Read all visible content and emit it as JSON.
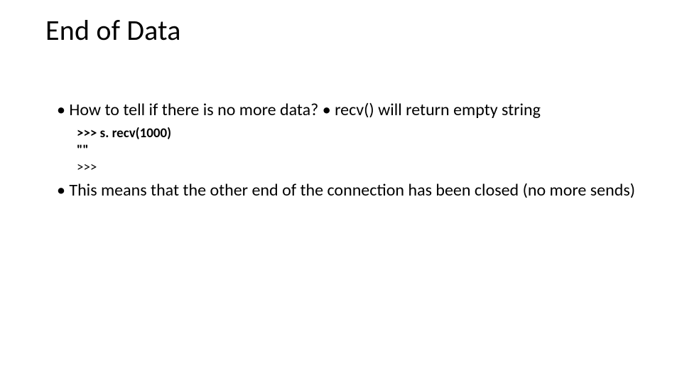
{
  "title": "End of Data",
  "bullet1": "• How to tell if there is no more data? • recv() will return empty string",
  "code": {
    "line1": ">>> s. recv(1000)",
    "line2": "\"\"",
    "line3": ">>>"
  },
  "bullet2": "• This means that the other end of the connection has been closed (no more sends)"
}
